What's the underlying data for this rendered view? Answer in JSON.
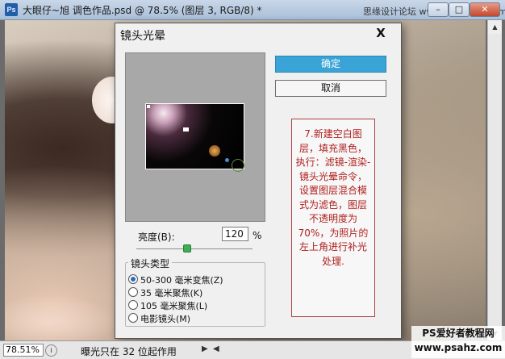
{
  "document": {
    "app_icon": "Ps",
    "title": "大眼仔~旭 调色作品.psd @ 78.5% (图层 3, RGB/8) *",
    "watermark": "思缘设计论坛 www.missyuan.com",
    "controls": [
      "minimize-icon",
      "maximize-icon",
      "close-icon"
    ]
  },
  "dialog": {
    "title": "镜头光晕",
    "close_label": "X",
    "ok_label": "确定",
    "cancel_label": "取消",
    "brightness_label": "亮度(B):",
    "brightness_value": "120",
    "brightness_unit": "%",
    "brightness_slider_percent": 43,
    "lens_type_label": "镜头类型",
    "lens_options": [
      {
        "label": "50-300 毫米变焦(Z)",
        "selected": true
      },
      {
        "label": "35 毫米聚焦(K)",
        "selected": false
      },
      {
        "label": "105 毫米聚焦(L)",
        "selected": false
      },
      {
        "label": "电影镜头(M)",
        "selected": false
      }
    ],
    "note": "7.新建空白图层，填充黑色，执行：滤镜-渲染-镜头光晕命令，设置图层混合模式为滤色，图层不透明度为70%，为照片的左上角进行补光处理."
  },
  "statusbar": {
    "zoom": "78.51%",
    "info": "曝光只在 32 位起作用"
  },
  "site_watermark": {
    "line1": "PS爱好者教程网",
    "line2": "www.psahz.com"
  },
  "colors": {
    "primary_button": "#3aa4d6",
    "note_text": "#b02020"
  }
}
